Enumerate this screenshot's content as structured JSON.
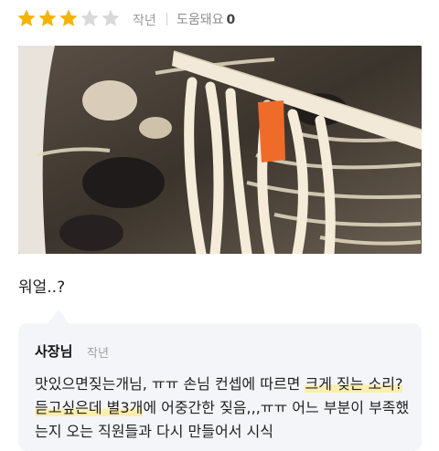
{
  "rating": {
    "value": 3,
    "max": 5,
    "filled_color": "#f5b301",
    "empty_color": "#d9d9d9"
  },
  "review": {
    "date": "작년",
    "helpful_label": "도움돼요",
    "helpful_count": "0",
    "text": "워얼..?"
  },
  "reply": {
    "author": "사장님",
    "date": "작년",
    "parts": [
      {
        "text": "맛있으면짖는개님, ㅠㅠ 손님 컨셉에 따르면 ",
        "highlight": false
      },
      {
        "text": "크게 짖는 소리? 듣고싶은데 별3개",
        "highlight": true
      },
      {
        "text": "에 어중간한 짖음,,,ㅠㅠ 어느 부분이 부족했는지 오는 직원들과 다시 만들어서 시식",
        "highlight": false
      }
    ]
  }
}
